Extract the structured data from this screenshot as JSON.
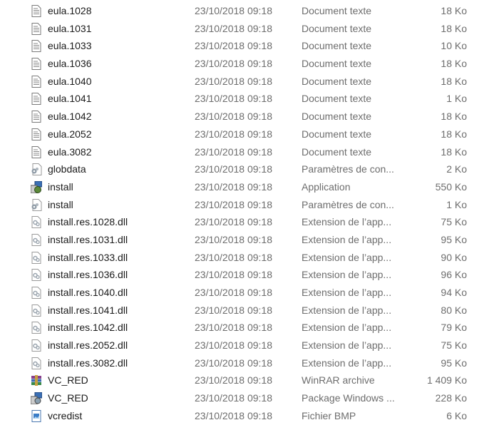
{
  "files": [
    {
      "name": "eula.1028",
      "date": "23/10/2018 09:18",
      "type": "Document texte",
      "size": "18 Ko",
      "icon": "text-file-icon"
    },
    {
      "name": "eula.1031",
      "date": "23/10/2018 09:18",
      "type": "Document texte",
      "size": "18 Ko",
      "icon": "text-file-icon"
    },
    {
      "name": "eula.1033",
      "date": "23/10/2018 09:18",
      "type": "Document texte",
      "size": "10 Ko",
      "icon": "text-file-icon"
    },
    {
      "name": "eula.1036",
      "date": "23/10/2018 09:18",
      "type": "Document texte",
      "size": "18 Ko",
      "icon": "text-file-icon"
    },
    {
      "name": "eula.1040",
      "date": "23/10/2018 09:18",
      "type": "Document texte",
      "size": "18 Ko",
      "icon": "text-file-icon"
    },
    {
      "name": "eula.1041",
      "date": "23/10/2018 09:18",
      "type": "Document texte",
      "size": "1 Ko",
      "icon": "text-file-icon"
    },
    {
      "name": "eula.1042",
      "date": "23/10/2018 09:18",
      "type": "Document texte",
      "size": "18 Ko",
      "icon": "text-file-icon"
    },
    {
      "name": "eula.2052",
      "date": "23/10/2018 09:18",
      "type": "Document texte",
      "size": "18 Ko",
      "icon": "text-file-icon"
    },
    {
      "name": "eula.3082",
      "date": "23/10/2018 09:18",
      "type": "Document texte",
      "size": "18 Ko",
      "icon": "text-file-icon"
    },
    {
      "name": "globdata",
      "date": "23/10/2018 09:18",
      "type": "Paramètres de con...",
      "size": "2 Ko",
      "icon": "config-file-icon"
    },
    {
      "name": "install",
      "date": "23/10/2018 09:18",
      "type": "Application",
      "size": "550 Ko",
      "icon": "installer-icon"
    },
    {
      "name": "install",
      "date": "23/10/2018 09:18",
      "type": "Paramètres de con...",
      "size": "1 Ko",
      "icon": "config-file-icon"
    },
    {
      "name": "install.res.1028.dll",
      "date": "23/10/2018 09:18",
      "type": "Extension de l’app...",
      "size": "75 Ko",
      "icon": "dll-file-icon"
    },
    {
      "name": "install.res.1031.dll",
      "date": "23/10/2018 09:18",
      "type": "Extension de l’app...",
      "size": "95 Ko",
      "icon": "dll-file-icon"
    },
    {
      "name": "install.res.1033.dll",
      "date": "23/10/2018 09:18",
      "type": "Extension de l’app...",
      "size": "90 Ko",
      "icon": "dll-file-icon"
    },
    {
      "name": "install.res.1036.dll",
      "date": "23/10/2018 09:18",
      "type": "Extension de l’app...",
      "size": "96 Ko",
      "icon": "dll-file-icon"
    },
    {
      "name": "install.res.1040.dll",
      "date": "23/10/2018 09:18",
      "type": "Extension de l’app...",
      "size": "94 Ko",
      "icon": "dll-file-icon"
    },
    {
      "name": "install.res.1041.dll",
      "date": "23/10/2018 09:18",
      "type": "Extension de l’app...",
      "size": "80 Ko",
      "icon": "dll-file-icon"
    },
    {
      "name": "install.res.1042.dll",
      "date": "23/10/2018 09:18",
      "type": "Extension de l’app...",
      "size": "79 Ko",
      "icon": "dll-file-icon"
    },
    {
      "name": "install.res.2052.dll",
      "date": "23/10/2018 09:18",
      "type": "Extension de l’app...",
      "size": "75 Ko",
      "icon": "dll-file-icon"
    },
    {
      "name": "install.res.3082.dll",
      "date": "23/10/2018 09:18",
      "type": "Extension de l’app...",
      "size": "95 Ko",
      "icon": "dll-file-icon"
    },
    {
      "name": "VC_RED",
      "date": "23/10/2018 09:18",
      "type": "WinRAR archive",
      "size": "1 409 Ko",
      "icon": "winrar-archive-icon"
    },
    {
      "name": "VC_RED",
      "date": "23/10/2018 09:18",
      "type": "Package Windows ...",
      "size": "228 Ko",
      "icon": "windows-installer-package-icon"
    },
    {
      "name": "vcredist",
      "date": "23/10/2018 09:18",
      "type": "Fichier BMP",
      "size": "6 Ko",
      "icon": "bmp-image-icon"
    }
  ]
}
